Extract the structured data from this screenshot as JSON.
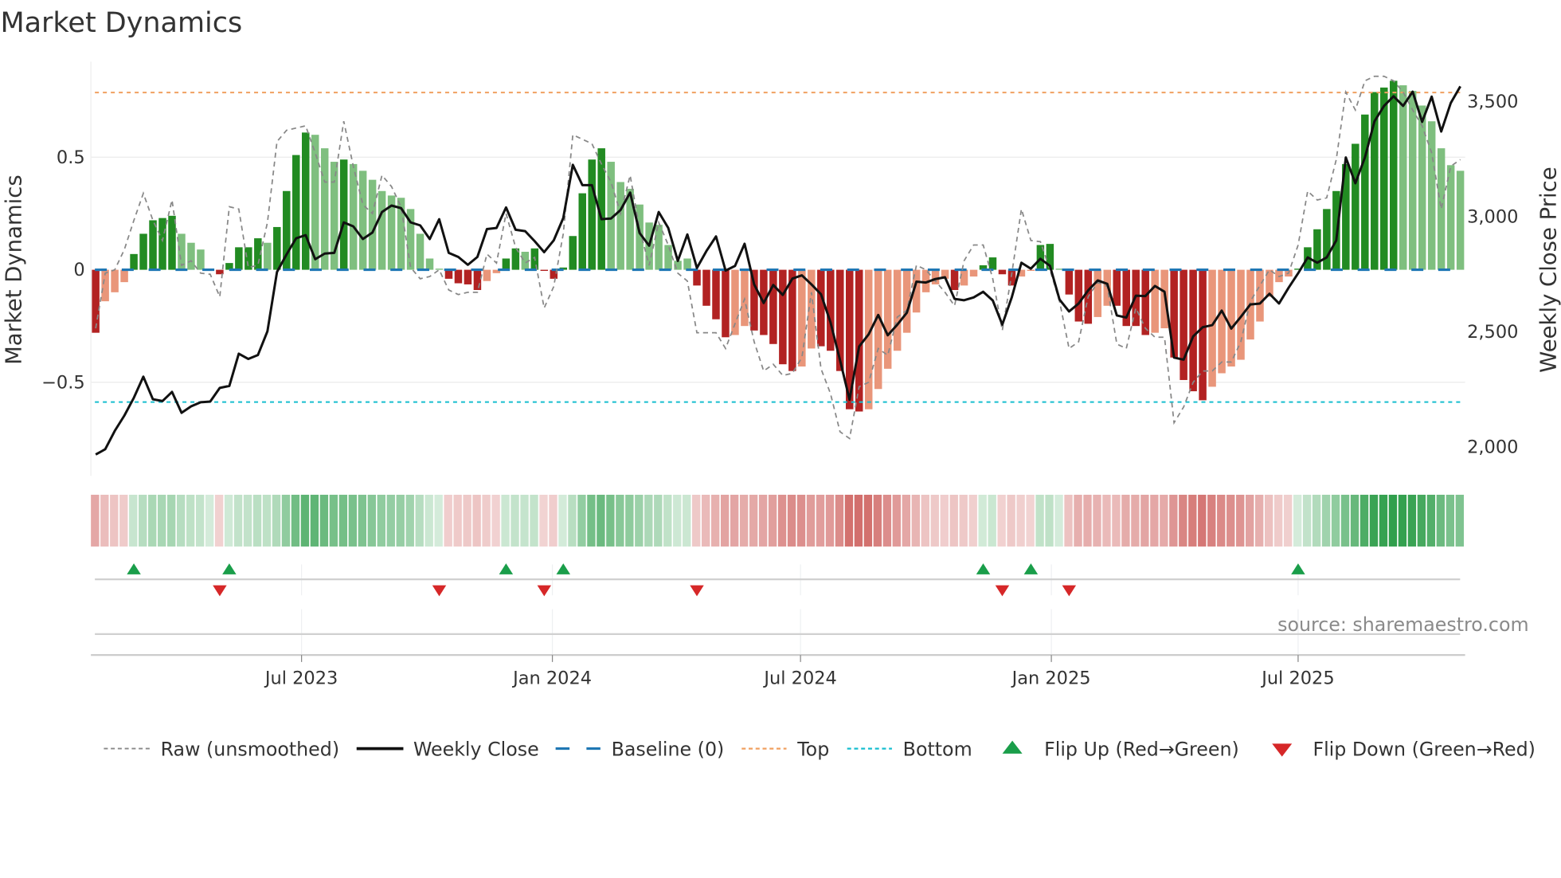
{
  "title": "Market Dynamics",
  "source": "source: sharemaestro.com",
  "colors": {
    "strong_green": "#228b22",
    "fading_green": "#7fbf7f",
    "strong_red": "#b22222",
    "fading_red": "#e9967a",
    "raw": "#888888",
    "close": "#111111",
    "baseline": "#1f77b4",
    "top": "#f0a060",
    "bottom": "#17becf",
    "flip_up": "#1a9e4a",
    "flip_down": "#d62728",
    "heat_green": "#2e9e4a",
    "heat_red": "#c9524f"
  },
  "legend": {
    "raw": "Raw (unsmoothed)",
    "close": "Weekly Close",
    "baseline": "Baseline (0)",
    "top": "Top",
    "bottom": "Bottom",
    "flip_up": "Flip Up (Red→Green)",
    "flip_down": "Flip Down (Green→Red)"
  },
  "chart_data": {
    "type": "bar",
    "title": "Market Dynamics",
    "ylabel": "Market Dynamics",
    "y2label": "Weekly Close Price",
    "x_start": "2023-01-31",
    "x_step_days": 7,
    "ylim": [
      -0.92,
      0.92
    ],
    "y2lim": [
      1850,
      3650
    ],
    "yticks": [
      {
        "v": 0.5,
        "label": "0.5"
      },
      {
        "v": 0,
        "label": "0"
      },
      {
        "v": -0.5,
        "label": "−0.5"
      }
    ],
    "y2ticks": [
      {
        "v": 3500,
        "label": "3,500"
      },
      {
        "v": 3000,
        "label": "3,000"
      },
      {
        "v": 2500,
        "label": "2,500"
      },
      {
        "v": 2000,
        "label": "2,000"
      }
    ],
    "xticks": [
      {
        "date": "2023-07-01",
        "label": "Jul 2023"
      },
      {
        "date": "2024-01-01",
        "label": "Jan 2024"
      },
      {
        "date": "2024-07-01",
        "label": "Jul 2024"
      },
      {
        "date": "2025-01-01",
        "label": "Jan 2025"
      },
      {
        "date": "2025-07-01",
        "label": "Jul 2025"
      }
    ],
    "top_level": 0.788,
    "bottom_level": -0.588,
    "baseline": 0,
    "dynamics": [
      -0.28,
      -0.14,
      -0.1,
      -0.055,
      0.07,
      0.16,
      0.22,
      0.23,
      0.24,
      0.16,
      0.12,
      0.09,
      0.005,
      -0.02,
      0.03,
      0.1,
      0.1,
      0.14,
      0.12,
      0.19,
      0.35,
      0.51,
      0.61,
      0.6,
      0.54,
      0.48,
      0.49,
      0.47,
      0.44,
      0.4,
      0.35,
      0.33,
      0.32,
      0.27,
      0.16,
      0.05,
      0.005,
      -0.04,
      -0.06,
      -0.065,
      -0.09,
      -0.05,
      -0.015,
      0.05,
      0.095,
      0.08,
      0.095,
      -0.005,
      -0.04,
      0.01,
      0.15,
      0.34,
      0.49,
      0.54,
      0.48,
      0.39,
      0.36,
      0.29,
      0.21,
      0.2,
      0.11,
      0.04,
      0.05,
      -0.07,
      -0.16,
      -0.22,
      -0.3,
      -0.29,
      -0.25,
      -0.27,
      -0.29,
      -0.33,
      -0.42,
      -0.45,
      -0.43,
      -0.35,
      -0.34,
      -0.36,
      -0.45,
      -0.62,
      -0.63,
      -0.62,
      -0.53,
      -0.44,
      -0.36,
      -0.28,
      -0.19,
      -0.1,
      -0.065,
      -0.04,
      -0.09,
      -0.07,
      -0.03,
      0.02,
      0.055,
      -0.02,
      -0.07,
      -0.03,
      -0.005,
      0.11,
      0.115,
      0.005,
      -0.11,
      -0.23,
      -0.24,
      -0.21,
      -0.16,
      -0.16,
      -0.25,
      -0.25,
      -0.29,
      -0.28,
      -0.26,
      -0.39,
      -0.49,
      -0.54,
      -0.58,
      -0.52,
      -0.46,
      -0.43,
      -0.4,
      -0.31,
      -0.23,
      -0.12,
      -0.055,
      -0.03,
      0.005,
      0.1,
      0.18,
      0.27,
      0.35,
      0.47,
      0.56,
      0.69,
      0.79,
      0.81,
      0.84,
      0.82,
      0.795,
      0.73,
      0.66,
      0.54,
      0.465,
      0.44
    ],
    "strong": [
      1,
      0,
      0,
      0,
      1,
      1,
      1,
      1,
      1,
      0,
      0,
      0,
      0,
      1,
      1,
      1,
      1,
      1,
      0,
      1,
      1,
      1,
      1,
      0,
      0,
      0,
      1,
      0,
      0,
      0,
      0,
      0,
      0,
      0,
      0,
      0,
      0,
      1,
      1,
      1,
      1,
      0,
      0,
      1,
      1,
      0,
      1,
      1,
      1,
      1,
      1,
      1,
      1,
      1,
      0,
      0,
      0,
      0,
      0,
      0,
      0,
      0,
      0,
      1,
      1,
      1,
      1,
      0,
      0,
      1,
      1,
      1,
      1,
      1,
      0,
      0,
      1,
      1,
      1,
      1,
      1,
      0,
      0,
      0,
      0,
      0,
      0,
      0,
      0,
      0,
      1,
      0,
      0,
      1,
      1,
      1,
      1,
      0,
      0,
      1,
      1,
      0,
      1,
      1,
      1,
      0,
      0,
      1,
      1,
      1,
      1,
      0,
      0,
      1,
      1,
      1,
      1,
      0,
      0,
      0,
      0,
      0,
      0,
      0,
      0,
      0,
      1,
      1,
      1,
      1,
      1,
      1,
      1,
      1,
      1,
      1,
      1,
      0,
      0,
      0,
      0,
      0,
      0,
      0
    ],
    "raw": [
      -0.26,
      -0.015,
      0,
      0.09,
      0.22,
      0.34,
      0.22,
      0.13,
      0.31,
      0.02,
      0.04,
      -0.015,
      -0.02,
      -0.12,
      0.28,
      0.27,
      0.01,
      0.02,
      0.21,
      0.57,
      0.62,
      0.63,
      0.64,
      0.52,
      0.39,
      0.39,
      0.66,
      0.46,
      0.29,
      0.25,
      0.42,
      0.37,
      0.28,
      0.01,
      -0.04,
      -0.03,
      0.0,
      -0.09,
      -0.11,
      -0.1,
      -0.1,
      0.07,
      0.03,
      0.25,
      0.1,
      0.03,
      0.055,
      -0.17,
      -0.075,
      0.16,
      0.6,
      0.58,
      0.56,
      0.47,
      0.39,
      0.25,
      0.42,
      0.18,
      0.02,
      0.21,
      0.11,
      -0.015,
      -0.05,
      -0.28,
      -0.28,
      -0.28,
      -0.35,
      -0.24,
      -0.13,
      -0.32,
      -0.45,
      -0.42,
      -0.47,
      -0.46,
      -0.39,
      -0.1,
      -0.44,
      -0.55,
      -0.72,
      -0.75,
      -0.52,
      -0.5,
      -0.35,
      -0.38,
      -0.21,
      -0.18,
      0.02,
      0.0,
      -0.05,
      -0.1,
      -0.16,
      0.04,
      0.11,
      0.11,
      -0.04,
      -0.27,
      -0.015,
      0.27,
      0.13,
      0.125,
      0.0,
      -0.14,
      -0.35,
      -0.32,
      -0.12,
      -0.056,
      -0.074,
      -0.33,
      -0.35,
      -0.17,
      -0.26,
      -0.3,
      -0.3,
      -0.68,
      -0.61,
      -0.5,
      -0.45,
      -0.45,
      -0.41,
      -0.41,
      -0.32,
      -0.14,
      -0.07,
      0.0,
      -0.03,
      -0.015,
      0.11,
      0.35,
      0.31,
      0.32,
      0.49,
      0.79,
      0.71,
      0.84,
      0.86,
      0.86,
      0.84,
      0.79,
      0.71,
      0.64,
      0.52,
      0.27,
      0.46,
      0.49
    ],
    "weekly_close": [
      1967,
      1990,
      2070,
      2136,
      2214,
      2305,
      2207,
      2199,
      2239,
      2148,
      2176,
      2194,
      2197,
      2256,
      2265,
      2405,
      2382,
      2399,
      2502,
      2760,
      2836,
      2906,
      2920,
      2815,
      2840,
      2843,
      2975,
      2958,
      2903,
      2931,
      3020,
      3048,
      3037,
      2975,
      2962,
      2903,
      2989,
      2843,
      2825,
      2791,
      2825,
      2946,
      2951,
      3040,
      2943,
      2937,
      2894,
      2846,
      2897,
      2994,
      3225,
      3137,
      3137,
      2989,
      2992,
      3029,
      3105,
      2929,
      2874,
      3020,
      2951,
      2808,
      2923,
      2777,
      2851,
      2914,
      2766,
      2786,
      2882,
      2706,
      2625,
      2703,
      2660,
      2731,
      2745,
      2706,
      2663,
      2542,
      2377,
      2205,
      2436,
      2489,
      2573,
      2485,
      2531,
      2583,
      2718,
      2714,
      2729,
      2737,
      2643,
      2637,
      2649,
      2674,
      2636,
      2531,
      2651,
      2800,
      2774,
      2817,
      2786,
      2640,
      2588,
      2623,
      2680,
      2723,
      2708,
      2571,
      2562,
      2657,
      2655,
      2699,
      2674,
      2388,
      2379,
      2480,
      2520,
      2529,
      2592,
      2514,
      2565,
      2619,
      2623,
      2665,
      2623,
      2691,
      2754,
      2823,
      2800,
      2823,
      2897,
      3257,
      3145,
      3257,
      3414,
      3481,
      3523,
      3481,
      3543,
      3412,
      3521,
      3370,
      3494,
      3566
    ],
    "flip_up_weeks": [
      4,
      14,
      43,
      49,
      93,
      98,
      126
    ],
    "flip_down_weeks": [
      13,
      36,
      47,
      63,
      95,
      102
    ],
    "legend_position": "bottom"
  }
}
